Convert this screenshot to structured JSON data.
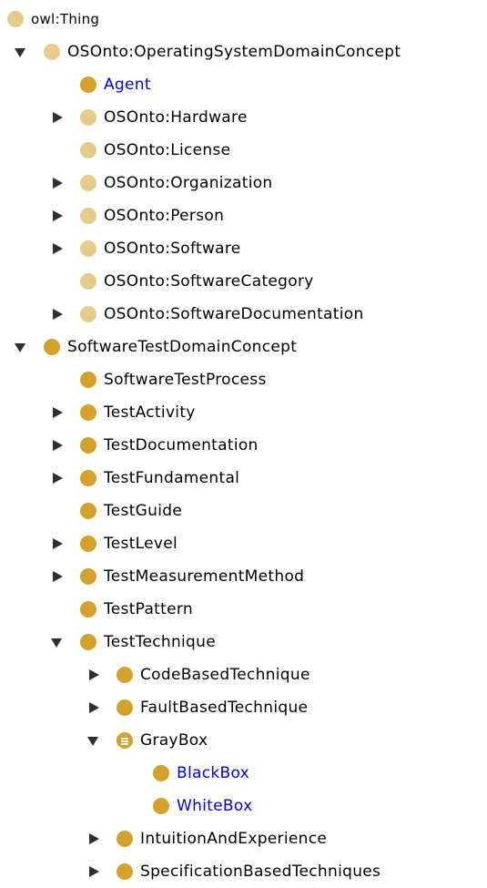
{
  "colors": {
    "triangle": "#2f2f2f",
    "dot_light": "#e6cc8c",
    "dot_dark": "#d4a12a",
    "label_default": "#000000",
    "label_linked": "#0000ee"
  },
  "tree": {
    "nodes": [
      {
        "label": "owl:Thing",
        "depth": 0,
        "toggle": "none",
        "icon": "class-light-icon",
        "linked": false,
        "defined": false
      },
      {
        "label": "OSOnto:OperatingSystemDomainConcept",
        "depth": 0,
        "toggle": "expanded",
        "icon": "class-light-icon",
        "linked": false,
        "defined": false
      },
      {
        "label": "Agent",
        "depth": 1,
        "toggle": "none",
        "icon": "class-dark-icon",
        "linked": true,
        "defined": false
      },
      {
        "label": "OSOnto:Hardware",
        "depth": 1,
        "toggle": "collapsed",
        "icon": "class-light-icon",
        "linked": false,
        "defined": false
      },
      {
        "label": "OSOnto:License",
        "depth": 1,
        "toggle": "none",
        "icon": "class-light-icon",
        "linked": false,
        "defined": false
      },
      {
        "label": "OSOnto:Organization",
        "depth": 1,
        "toggle": "collapsed",
        "icon": "class-light-icon",
        "linked": false,
        "defined": false
      },
      {
        "label": "OSOnto:Person",
        "depth": 1,
        "toggle": "collapsed",
        "icon": "class-light-icon",
        "linked": false,
        "defined": false
      },
      {
        "label": "OSOnto:Software",
        "depth": 1,
        "toggle": "collapsed",
        "icon": "class-light-icon",
        "linked": false,
        "defined": false
      },
      {
        "label": "OSOnto:SoftwareCategory",
        "depth": 1,
        "toggle": "none",
        "icon": "class-light-icon",
        "linked": false,
        "defined": false
      },
      {
        "label": "OSOnto:SoftwareDocumentation",
        "depth": 1,
        "toggle": "collapsed",
        "icon": "class-light-icon",
        "linked": false,
        "defined": false
      },
      {
        "label": "SoftwareTestDomainConcept",
        "depth": 0,
        "toggle": "expanded",
        "icon": "class-dark-icon",
        "linked": false,
        "defined": false
      },
      {
        "label": "SoftwareTestProcess",
        "depth": 1,
        "toggle": "none",
        "icon": "class-dark-icon",
        "linked": false,
        "defined": false
      },
      {
        "label": "TestActivity",
        "depth": 1,
        "toggle": "collapsed",
        "icon": "class-dark-icon",
        "linked": false,
        "defined": false
      },
      {
        "label": "TestDocumentation",
        "depth": 1,
        "toggle": "collapsed",
        "icon": "class-dark-icon",
        "linked": false,
        "defined": false
      },
      {
        "label": "TestFundamental",
        "depth": 1,
        "toggle": "collapsed",
        "icon": "class-dark-icon",
        "linked": false,
        "defined": false
      },
      {
        "label": "TestGuide",
        "depth": 1,
        "toggle": "none",
        "icon": "class-dark-icon",
        "linked": false,
        "defined": false
      },
      {
        "label": "TestLevel",
        "depth": 1,
        "toggle": "collapsed",
        "icon": "class-dark-icon",
        "linked": false,
        "defined": false
      },
      {
        "label": "TestMeasurementMethod",
        "depth": 1,
        "toggle": "collapsed",
        "icon": "class-dark-icon",
        "linked": false,
        "defined": false
      },
      {
        "label": "TestPattern",
        "depth": 1,
        "toggle": "none",
        "icon": "class-dark-icon",
        "linked": false,
        "defined": false
      },
      {
        "label": "TestTechnique",
        "depth": 1,
        "toggle": "expanded",
        "icon": "class-dark-icon",
        "linked": false,
        "defined": false
      },
      {
        "label": "CodeBasedTechnique",
        "depth": 2,
        "toggle": "collapsed",
        "icon": "class-dark-icon",
        "linked": false,
        "defined": false
      },
      {
        "label": "FaultBasedTechnique",
        "depth": 2,
        "toggle": "collapsed",
        "icon": "class-dark-icon",
        "linked": false,
        "defined": false
      },
      {
        "label": "GrayBox",
        "depth": 2,
        "toggle": "expanded",
        "icon": "defined-class-icon",
        "linked": false,
        "defined": true
      },
      {
        "label": "BlackBox",
        "depth": 3,
        "toggle": "none",
        "icon": "class-dark-icon",
        "linked": true,
        "defined": false
      },
      {
        "label": "WhiteBox",
        "depth": 3,
        "toggle": "none",
        "icon": "class-dark-icon",
        "linked": true,
        "defined": false
      },
      {
        "label": "IntuitionAndExperience",
        "depth": 2,
        "toggle": "collapsed",
        "icon": "class-dark-icon",
        "linked": false,
        "defined": false
      },
      {
        "label": "SpecificationBasedTechniques",
        "depth": 2,
        "toggle": "collapsed",
        "icon": "class-dark-icon",
        "linked": false,
        "defined": false
      }
    ]
  }
}
